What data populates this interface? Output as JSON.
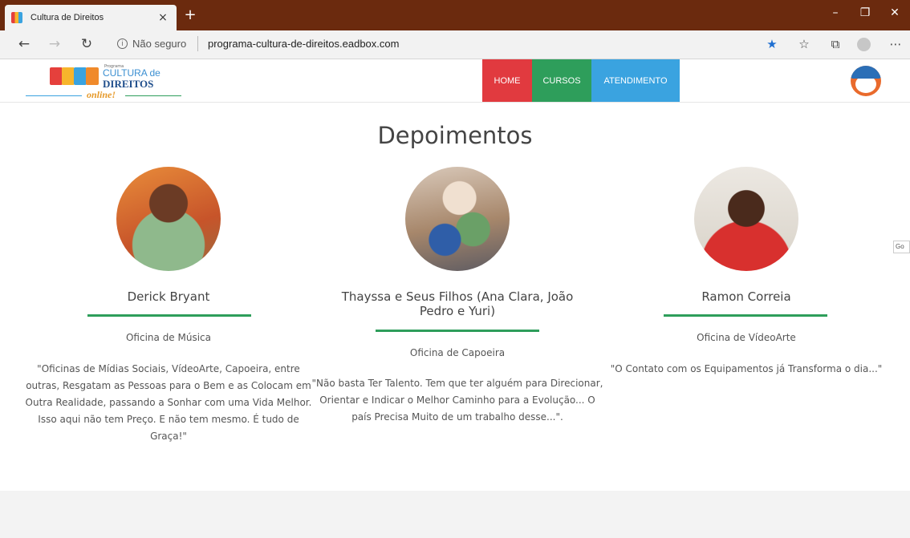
{
  "browser": {
    "tab_title": "Cultura de Direitos",
    "tab_close": "×",
    "new_tab": "+",
    "security_label": "Não seguro",
    "url": "programa-cultura-de-direitos.eadbox.com",
    "icons": [
      "back-icon",
      "forward-icon",
      "refresh-icon",
      "info-icon",
      "favorite-star-icon",
      "favorites-list-icon",
      "collections-icon",
      "profile-icon",
      "more-icon",
      "minimize-icon",
      "maximize-icon",
      "close-icon"
    ]
  },
  "site": {
    "logo": {
      "small": "Programa",
      "top": "CULTURA de",
      "main": "DIREITOS",
      "online": "online!"
    },
    "menu": [
      {
        "label": "HOME",
        "color": "#e13a3f"
      },
      {
        "label": "CURSOS",
        "color": "#2e9e5b"
      },
      {
        "label": "ATENDIMENTO",
        "color": "#3aa3e0"
      }
    ],
    "side_tag": "Go"
  },
  "testimonials": {
    "title": "Depoimentos",
    "items": [
      {
        "name": "Derick Bryant",
        "workshop": "Oficina de Música",
        "quote": "\"Oficinas de Mídias Sociais, VídeoArte, Capoeira, entre outras, Resgatam as Pessoas para o Bem e as Colocam em Outra Realidade, passando a Sonhar com uma Vida Melhor. Isso aqui não tem Preço. E não tem mesmo. É tudo de Graça!\""
      },
      {
        "name": "Thayssa e Seus Filhos (Ana Clara, João Pedro e Yuri)",
        "workshop": "Oficina de Capoeira",
        "quote": "\"Não basta Ter Talento. Tem que ter alguém para Direcionar, Orientar e Indicar o Melhor Caminho para a Evolução... O país Precisa Muito de um trabalho desse...\"."
      },
      {
        "name": "Ramon Correia",
        "workshop": "Oficina de VídeoArte",
        "quote": "\"O Contato com os Equipamentos já Transforma o dia...\""
      }
    ]
  }
}
